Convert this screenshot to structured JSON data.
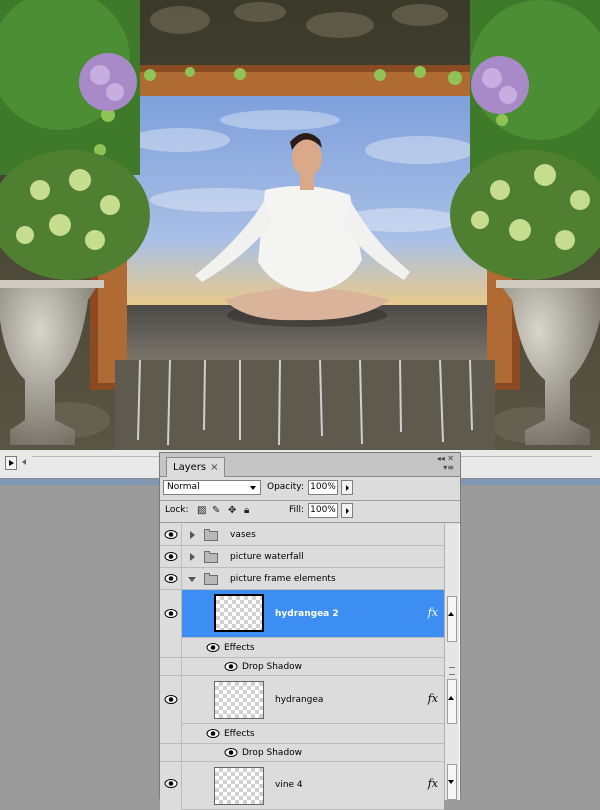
{
  "panel": {
    "tab_label": "Layers",
    "tab_close": "×",
    "blend_mode": "Normal",
    "opacity_label": "Opacity:",
    "opacity_value": "100%",
    "lock_label": "Lock:",
    "fill_label": "Fill:",
    "fill_value": "100%"
  },
  "layers": [
    {
      "name": "vases",
      "type": "group",
      "expanded": false
    },
    {
      "name": "picture waterfall",
      "type": "group",
      "expanded": false
    },
    {
      "name": "picture frame elements",
      "type": "group",
      "expanded": true
    },
    {
      "name": "hydrangea 2",
      "type": "layer",
      "selected": true,
      "fx": "fx"
    },
    {
      "name": "Effects",
      "type": "effects"
    },
    {
      "name": "Drop Shadow",
      "type": "effect"
    },
    {
      "name": "hydrangea",
      "type": "layer",
      "selected": false,
      "fx": "fx"
    },
    {
      "name": "Effects",
      "type": "effects"
    },
    {
      "name": "Drop Shadow",
      "type": "effect"
    },
    {
      "name": "vine 4",
      "type": "layer",
      "selected": false,
      "fx": "fx"
    }
  ],
  "colors": {
    "selection": "#3d8ef2",
    "panel_bg": "#dcdcdc",
    "canvas_bg": "#9b9b9b"
  }
}
